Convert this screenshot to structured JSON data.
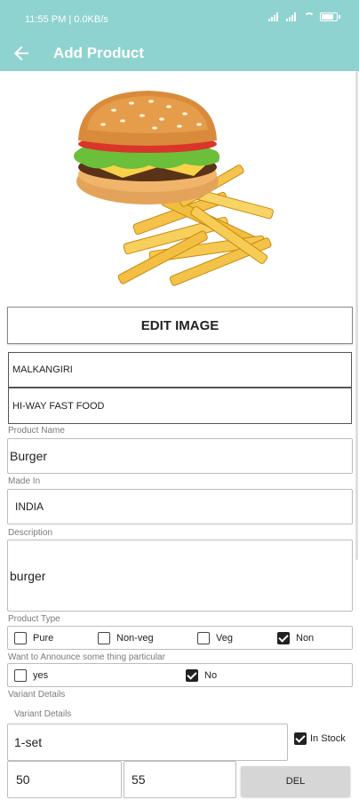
{
  "status_bar": {
    "time": "11:55 PM | 0.0KB/s",
    "battery_icon": "battery-icon",
    "wifi_icon": "wifi-icon"
  },
  "app_bar": {
    "title": "Add Product",
    "back_icon": "arrow-left-icon",
    "background": "#8fd3d0"
  },
  "product_image": {
    "icon": "burger-fries-image"
  },
  "edit_image_button": "EDIT IMAGE",
  "location": "MALKANGIRI",
  "shop_name": "HI-WAY FAST FOOD",
  "product_name": {
    "label": "Product Name",
    "value": "Burger"
  },
  "made_in": {
    "label": "Made In",
    "value": "INDIA"
  },
  "description": {
    "label": "Description",
    "value": "burger"
  },
  "product_type": {
    "label": "Product Type",
    "options": [
      {
        "label": "Pure",
        "checked": false
      },
      {
        "label": "Non-veg",
        "checked": false
      },
      {
        "label": "Veg",
        "checked": false
      },
      {
        "label": "Non",
        "checked": true
      }
    ]
  },
  "announce": {
    "label": "Want to Announce some thing particular",
    "options": [
      {
        "label": "yes",
        "checked": false
      },
      {
        "label": "No",
        "checked": true
      }
    ]
  },
  "variant_section_label": "Variant Details",
  "variant": {
    "label": "Variant Details",
    "name": "1-set",
    "in_stock_label": "In Stock",
    "in_stock": true,
    "price1": "50",
    "price2": "55",
    "delete_label": "DEL"
  }
}
